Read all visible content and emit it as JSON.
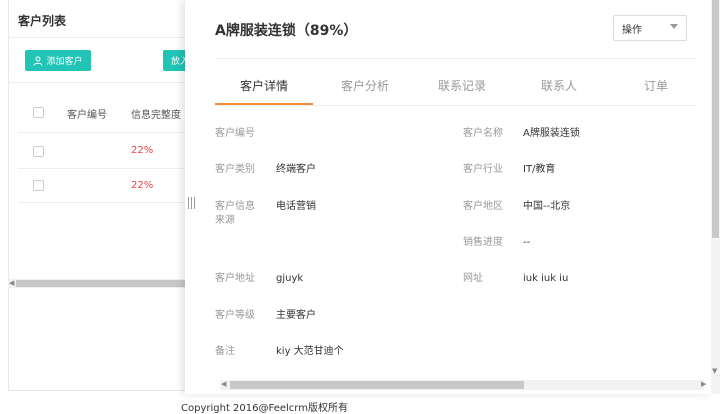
{
  "list": {
    "title": "客户列表",
    "add_button": "添加客户",
    "partial_button": "放入",
    "headers": [
      "客户编号",
      "信息完整度"
    ],
    "rows": [
      {
        "number": "",
        "completeness": "22%"
      },
      {
        "number": "",
        "completeness": "22%"
      }
    ]
  },
  "drawer": {
    "title": "A牌服装连锁（89%）",
    "operation_select": "操作",
    "tabs": [
      "客户详情",
      "客户分析",
      "联系记录",
      "联系人",
      "订单"
    ],
    "active_tab": "客户详情",
    "fields": {
      "customer_number": {
        "label": "客户编号",
        "value": ""
      },
      "customer_name": {
        "label": "客户名称",
        "value": "A牌服装连锁"
      },
      "customer_type": {
        "label": "客户类别",
        "value": "终端客户"
      },
      "customer_industry": {
        "label": "客户行业",
        "value": "IT/教育"
      },
      "info_source": {
        "label": "客户信息来源",
        "value": "电话营销"
      },
      "customer_region": {
        "label": "客户地区",
        "value": "中国--北京"
      },
      "sales_progress": {
        "label": "销售进度",
        "value": "--"
      },
      "customer_address": {
        "label": "客户地址",
        "value": "gjuyk"
      },
      "website": {
        "label": "网址",
        "value": "iuk iuk iu"
      },
      "customer_level": {
        "label": "客户等级",
        "value": "主要客户"
      },
      "remark": {
        "label": "备注",
        "value": "kiy 大范甘迪个"
      }
    }
  },
  "footer": {
    "copyright": "Copyright 2016@Feelcrm版权所有"
  },
  "colors": {
    "accent": "#21c4b5",
    "tab_underline": "#f08c36",
    "warning_text": "#e64545"
  }
}
